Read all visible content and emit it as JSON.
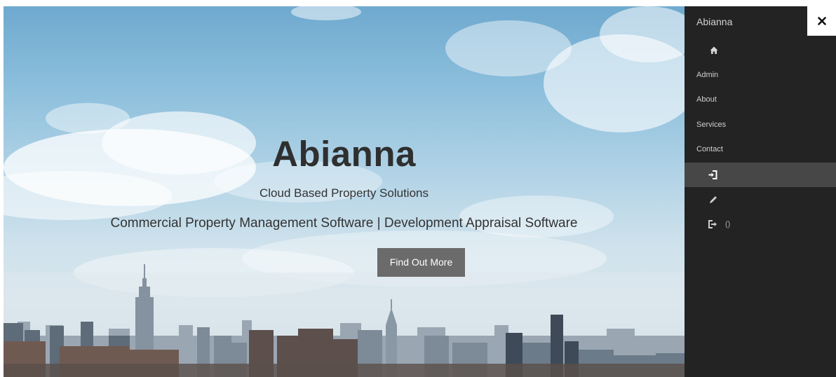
{
  "hero": {
    "title": "Abianna",
    "subtitle": "Cloud Based Property Solutions",
    "tagline": "Commercial Property Management Software | Development Appraisal Software",
    "cta_label": "Find Out More"
  },
  "sidebar": {
    "brand": "Abianna",
    "close_icon": "close-icon",
    "items": [
      {
        "icon": "home-icon"
      },
      {
        "label": "Admin"
      },
      {
        "label": "About"
      },
      {
        "label": "Services"
      },
      {
        "label": "Contact"
      },
      {
        "icon": "sign-in-icon",
        "active": true
      },
      {
        "icon": "pencil-icon"
      },
      {
        "icon": "sign-out-icon",
        "label": "()"
      }
    ]
  },
  "colors": {
    "sidebar_bg": "#232323",
    "sidebar_active": "#474747",
    "button_bg": "#6b6b6b",
    "title_text": "#2f2f2f"
  }
}
